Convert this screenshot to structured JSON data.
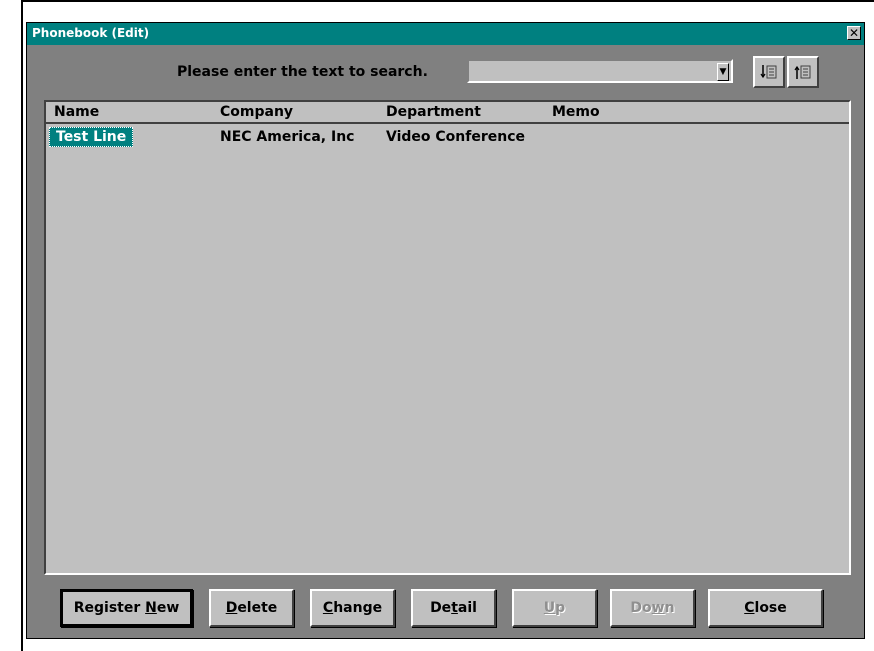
{
  "window": {
    "title": "Phonebook (Edit)",
    "close_glyph": "✕"
  },
  "search": {
    "label": "Please enter the text to search.",
    "value": "",
    "dropdown_icon": "down-arrow-icon"
  },
  "toolbar": {
    "buttons": [
      {
        "name": "search-down-button",
        "icon": "search-down-icon"
      },
      {
        "name": "search-up-button",
        "icon": "search-up-icon"
      }
    ]
  },
  "list": {
    "columns": [
      "Name",
      "Company",
      "Department",
      "Memo",
      ""
    ],
    "rows": [
      {
        "name": "Test Line",
        "company": "NEC America, Inc",
        "department": "Video Conference",
        "memo": ""
      }
    ]
  },
  "buttons": {
    "register_new": {
      "pre": "Register ",
      "mn": "N",
      "post": "ew"
    },
    "delete": {
      "pre": "",
      "mn": "D",
      "post": "elete"
    },
    "change": {
      "pre": "",
      "mn": "C",
      "post": "hange"
    },
    "detail": {
      "pre": "De",
      "mn": "t",
      "post": "ail"
    },
    "up": {
      "pre": "",
      "mn": "U",
      "post": "p"
    },
    "down": {
      "pre": "Do",
      "mn": "w",
      "post": "n"
    },
    "close": {
      "pre": "",
      "mn": "C",
      "post": "lose"
    }
  },
  "colors": {
    "titlebar": "#008080",
    "selection": "#008080",
    "face": "#c0c0c0",
    "frame": "#808080"
  }
}
